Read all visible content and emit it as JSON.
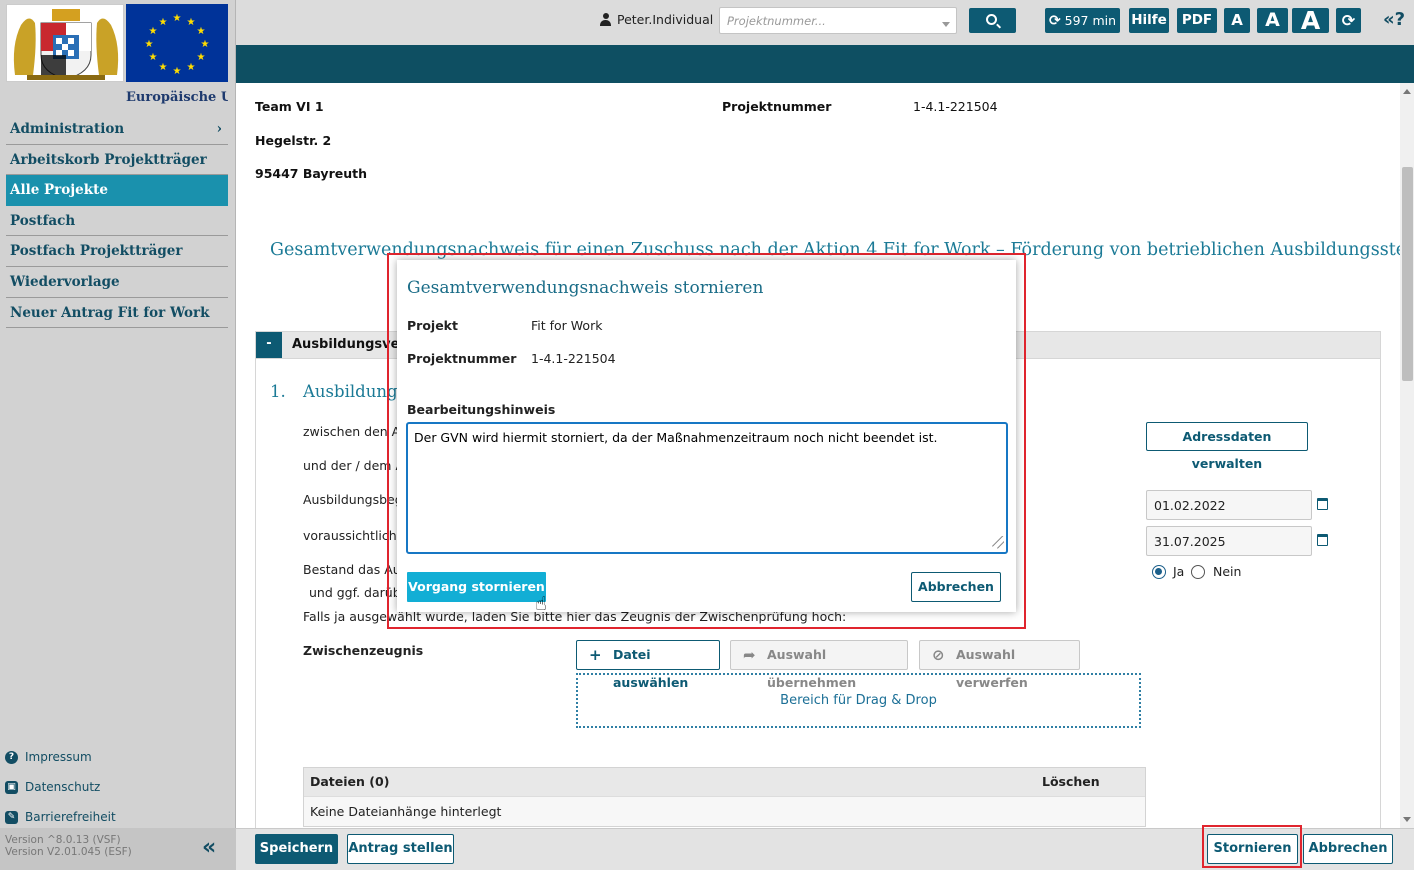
{
  "sidebar": {
    "eu_label": "Europäische Uni",
    "nav": [
      {
        "label": "Administration",
        "active": false,
        "has_chevron": true
      },
      {
        "label": "Arbeitskorb Projektträger",
        "active": false
      },
      {
        "label": "Alle Projekte",
        "active": true
      },
      {
        "label": "Postfach",
        "active": false
      },
      {
        "label": "Postfach Projektträger",
        "active": false
      },
      {
        "label": "Wiedervorlage",
        "active": false
      },
      {
        "label": "Neuer Antrag Fit for Work",
        "active": false
      }
    ],
    "chevron": "›",
    "footer_links": [
      {
        "label": "Impressum",
        "icon": "question-circle-icon",
        "glyph": "?"
      },
      {
        "label": "Datenschutz",
        "icon": "user-id-icon",
        "glyph": "▣"
      },
      {
        "label": "Barrierefreiheit",
        "icon": "edit-icon",
        "glyph": "✎"
      }
    ],
    "version1": "Version ^8.0.13 (VSF)",
    "version2": "Version V2.01.045 (ESF)",
    "collapse_glyph": "«"
  },
  "topbar": {
    "user": "Peter.Individual",
    "project_placeholder": "Projektnummer...",
    "timer": "597 min",
    "timer_icon": "⟳",
    "help": "Hilfe",
    "pdf": "PDF",
    "font_small": "A",
    "font_medium": "A",
    "font_large": "A",
    "refresh_glyph": "⟳",
    "help_corner": "«?"
  },
  "header": {
    "team": "Team VI 1",
    "street": "Hegelstr. 2",
    "city": "95447 Bayreuth",
    "project_number_label": "Projektnummer",
    "project_number": "1-4.1-221504"
  },
  "main": {
    "title": "Gesamtverwendungsnachweis für einen Zuschuss nach der Aktion 4 Fit for Work – Förderung von betrieblichen Ausbildungsstellen aus",
    "section_toggle": "-",
    "section_title": "Ausbildungsverhä",
    "sub_number": "1.",
    "sub_title": "Ausbildungsv",
    "labels": {
      "zwischen": "zwischen den Ar",
      "und": "und der / dem A",
      "beginn": "Ausbildungsbeg",
      "voraussichtlich": "voraussichtliche",
      "bestand": "Bestand das Au",
      "darueber": "und ggf. darüb",
      "falls": "Falls ja ausgewählt wurde, laden Sie bitte hier das Zeugnis der Zwischenprüfung hoch:"
    },
    "address_button": "Adressdaten verwalten",
    "start_date": "01.02.2022",
    "end_date": "31.07.2025",
    "radio_yes": "Ja",
    "radio_no": "Nein",
    "radio_selected": "Ja",
    "zwischenzeugnis_label": "Zwischenzeugnis",
    "file_select": "Datei auswählen",
    "file_accept": "Auswahl übernehmen",
    "file_discard": "Auswahl verwerfen",
    "drop_zone": "Bereich für Drag & Drop",
    "files_header": "Dateien (0)",
    "files_delete": "Löschen",
    "files_empty": "Keine Dateianhänge hinterlegt"
  },
  "modal": {
    "title": "Gesamtverwendungsnachweis stornieren",
    "project_label": "Projekt",
    "project_value": "Fit for Work",
    "number_label": "Projektnummer",
    "number_value": "1-4.1-221504",
    "note_label": "Bearbeitungshinweis",
    "note_value": "Der GVN wird hiermit storniert, da der Maßnahmenzeitraum noch nicht beendet ist.",
    "confirm": "Vorgang stornieren",
    "cancel": "Abbrechen"
  },
  "bottombar": {
    "save": "Speichern",
    "submit": "Antrag stellen",
    "storno": "Stornieren",
    "cancel": "Abbrechen"
  },
  "colors": {
    "primary": "#0d5a73",
    "accent": "#12aed5",
    "highlight": "#e0252e",
    "banner": "#0e4f62"
  }
}
